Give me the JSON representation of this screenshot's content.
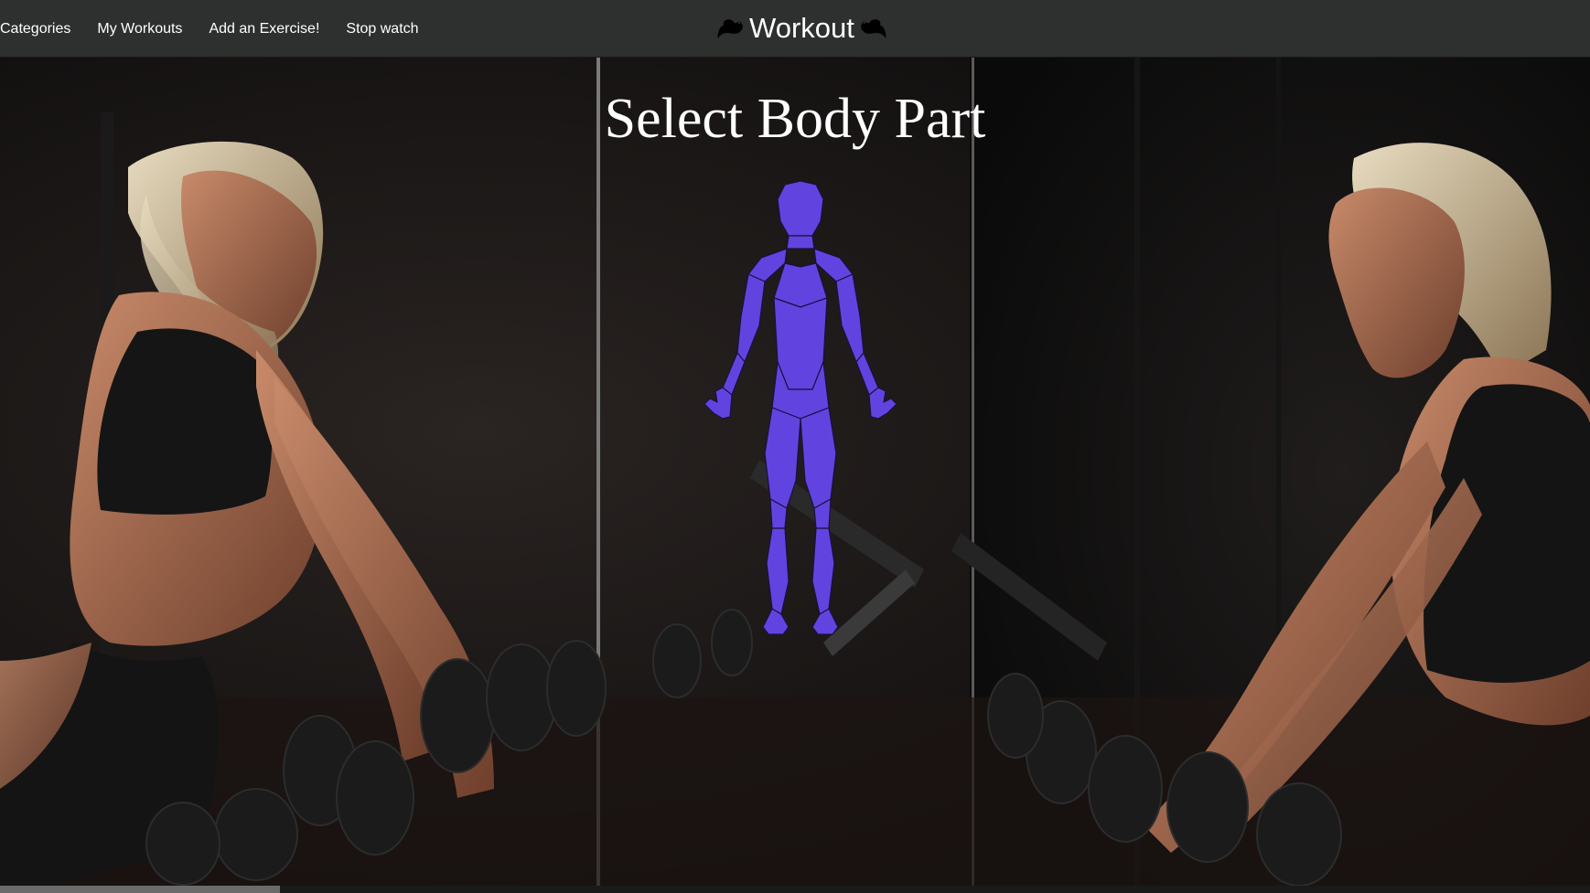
{
  "nav": {
    "links": [
      {
        "label": "Categories"
      },
      {
        "label": "My Workouts"
      },
      {
        "label": "Add an Exercise!"
      },
      {
        "label": "Stop watch"
      }
    ],
    "brand": "Workout",
    "brand_icon": "flexed-bicep-icon"
  },
  "main": {
    "heading": "Select Body Part",
    "figure_icon": "human-body-muscle-map-icon",
    "background": "gym-mirror-photo"
  },
  "colors": {
    "navbar": "#2e2f2f",
    "figure": "#6144e0",
    "text": "#ffffff"
  }
}
